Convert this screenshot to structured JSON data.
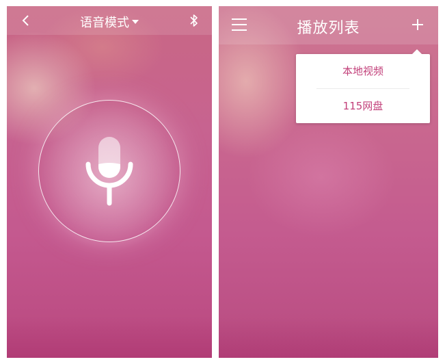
{
  "left_screen": {
    "header": {
      "title": "语音模式",
      "back_icon": "chevron-left-icon",
      "dropdown_icon": "caret-down-icon",
      "bluetooth_icon": "bluetooth-icon"
    },
    "mic_button_icon": "microphone-icon"
  },
  "right_screen": {
    "header": {
      "title": "播放列表",
      "menu_icon": "hamburger-menu-icon",
      "add_icon": "plus-icon"
    },
    "dropdown_menu": {
      "items": [
        {
          "label": "本地视频"
        },
        {
          "label": "115网盘"
        }
      ]
    }
  },
  "colors": {
    "accent": "#c2407a",
    "background": "#c4598f",
    "text_on_background": "#ffffff"
  }
}
